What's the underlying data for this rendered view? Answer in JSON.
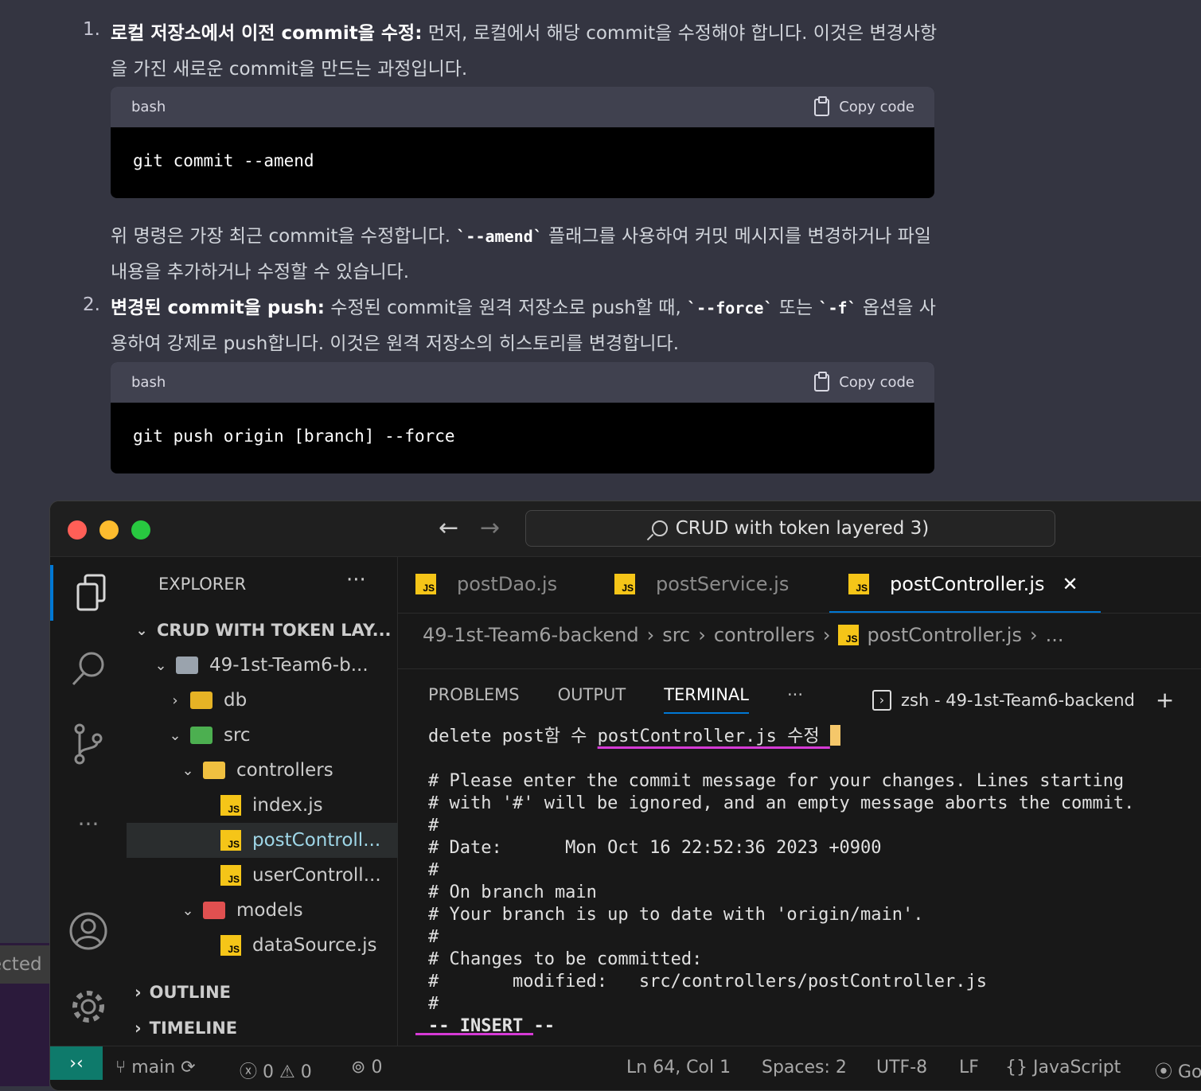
{
  "chat": {
    "item1_num": "1.",
    "item1_bold": "로컬 저장소에서 이전 commit을 수정:",
    "item1_text": " 먼저, 로컬에서 해당 commit을 수정해야 합니다. 이것은 변경사항을 가진 새로운 commit을 만드는 과정입니다.",
    "code1": {
      "lang": "bash",
      "copy": "Copy code",
      "code": "git commit --amend"
    },
    "note_pre": "위 명령은 가장 최근 commit을 수정합니다. ",
    "note_code": "`--amend`",
    "note_post": " 플래그를 사용하여 커밋 메시지를 변경하거나 파일 내용을 추가하거나 수정할 수 있습니다.",
    "item2_num": "2.",
    "item2_bold": "변경된 commit을 push:",
    "item2_pre": " 수정된 commit을 원격 저장소로 push할 때, ",
    "item2_code1": "`--force`",
    "item2_mid": " 또는 ",
    "item2_code2": "`-f`",
    "item2_post": " 옵션을 사용하여 강제로 push합니다. 이것은 원격 저장소의 히스토리를 변경합니다.",
    "code2": {
      "lang": "bash",
      "copy": "Copy code",
      "code": "git push origin [branch] --force"
    }
  },
  "vscode": {
    "search": "CRUD with token layered 3)",
    "nav_back": "←",
    "nav_forward": "→",
    "explorer_title": "EXPLORER",
    "explorer_more": "···",
    "tree": {
      "root": "CRUD WITH TOKEN LAY...",
      "project": "49-1st-Team6-b...",
      "db": "db",
      "src": "src",
      "controllers": "controllers",
      "index": "index.js",
      "postController": "postControll...",
      "userController": "userControll...",
      "models": "models",
      "dataSource": "dataSource.js"
    },
    "outline": "OUTLINE",
    "timeline": "TIMELINE",
    "tabs": [
      {
        "label": "postDao.js"
      },
      {
        "label": "postService.js"
      },
      {
        "label": "postController.js"
      }
    ],
    "tab_close": "✕",
    "js_badge": "JS",
    "breadcrumb": {
      "project": "49-1st-Team6-backend",
      "src": "src",
      "controllers": "controllers",
      "file": "postController.js",
      "more": "..."
    },
    "panel": {
      "problems": "PROBLEMS",
      "output": "OUTPUT",
      "terminal": "TERMINAL",
      "more": "···",
      "shell": "zsh - 49-1st-Team6-backend",
      "add": "+"
    },
    "terminal_lines": {
      "l1_pre": "delete post함 수 ",
      "l1_under": "postController.js 수정 ",
      "l2": "# Please enter the commit message for your changes. Lines starting",
      "l3": "# with '#' will be ignored, and an empty message aborts the commit.",
      "l4": "#",
      "l5": "# Date:      Mon Oct 16 22:52:36 2023 +0900",
      "l6": "#",
      "l7": "# On branch main",
      "l8": "# Your branch is up to date with 'origin/main'.",
      "l9": "#",
      "l10": "# Changes to be committed:",
      "l11": "#       modified:   src/controllers/postController.js",
      "l12": "#",
      "l13": "-- INSERT --"
    },
    "status": {
      "branch": "main",
      "errors": "0",
      "warnings": "0",
      "ports": "0",
      "position": "Ln 64, Col 1",
      "spaces": "Spaces: 2",
      "encoding": "UTF-8",
      "eol": "LF",
      "language": "JavaScript",
      "golive": "Go"
    }
  },
  "desktop": {
    "label": "ected"
  },
  "colors": {
    "accent": "#0078d4",
    "js_yellow": "#f5c518",
    "underline": "#d63ad6"
  }
}
